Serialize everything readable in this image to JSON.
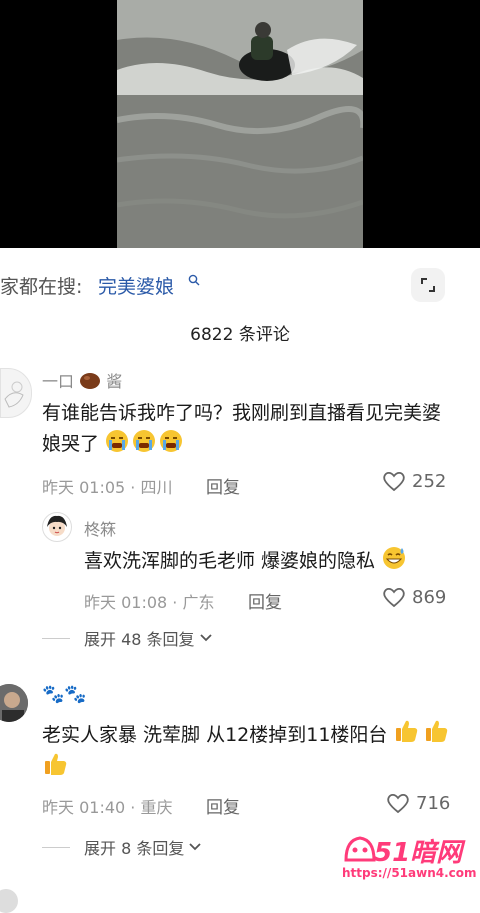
{
  "search": {
    "prefix": "家都在搜:",
    "term": "完美婆娘"
  },
  "comments_header": {
    "count_label": "6822 条评论"
  },
  "comments": [
    {
      "username": "一口",
      "username_suffix": "酱",
      "text_line1": "有谁能告诉我咋了吗？我刚刷到直播看见完美婆",
      "text_line2": "娘哭了",
      "meta": "昨天 01:05 · 四川",
      "reply_label": "回复",
      "likes": "252"
    },
    {
      "username": "柊箖",
      "text_line1": "喜欢洗浑脚的毛老师 爆婆娘的隐私",
      "meta": "昨天 01:08 · 广东",
      "reply_label": "回复",
      "likes": "869"
    },
    {
      "username": "🐾🐾",
      "text_line1": "老实人家暴 洗荤脚 从12楼掉到11楼阳台",
      "meta": "昨天 01:40 · 重庆",
      "reply_label": "回复",
      "likes": "716"
    }
  ],
  "expand_replies": [
    {
      "label": "展开 48 条回复"
    },
    {
      "label": "展开 8 条回复"
    }
  ],
  "watermark": {
    "title": "51暗网",
    "url": "https://51awn4.com"
  },
  "colors": {
    "accent_link": "#2b5aa8",
    "watermark": "#ff3b7a"
  }
}
